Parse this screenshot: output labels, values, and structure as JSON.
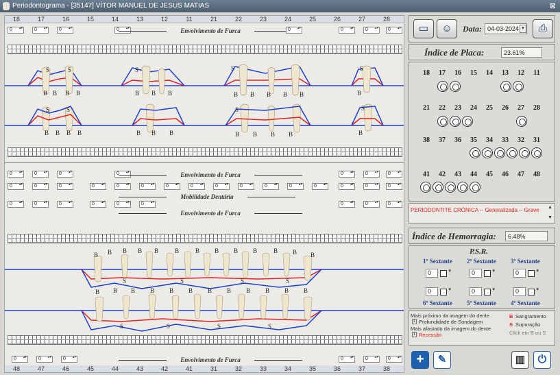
{
  "window": {
    "title": "Periodontograma - [35147] VÍTOR MANUEL DE JESUS MATIAS",
    "close": "⊠"
  },
  "chart": {
    "upper_teeth": [
      "18",
      "17",
      "16",
      "15",
      "14",
      "13",
      "12",
      "11",
      "21",
      "22",
      "23",
      "24",
      "25",
      "26",
      "27",
      "28"
    ],
    "lower_teeth": [
      "48",
      "47",
      "46",
      "45",
      "44",
      "43",
      "42",
      "41",
      "31",
      "32",
      "33",
      "34",
      "35",
      "36",
      "37",
      "38"
    ],
    "spinner_value": "0",
    "furca_label": "Envolvimento de Furca",
    "mobilidade_label": "Mobilidade Dentária",
    "bleed_marker": "B",
    "supp_marker": "S"
  },
  "toolbar": {
    "date_label": "Data:",
    "date_value": "04-03-2024"
  },
  "placa": {
    "label": "Índice de Placa:",
    "value": "23.61%"
  },
  "diagram": {
    "row1": [
      "18",
      "17",
      "16",
      "15",
      "14",
      "13",
      "12",
      "11"
    ],
    "row2": [
      "21",
      "22",
      "23",
      "24",
      "25",
      "26",
      "27",
      "28"
    ],
    "row3": [
      "38",
      "37",
      "36",
      "35",
      "34",
      "33",
      "32",
      "31"
    ],
    "row4": [
      "41",
      "42",
      "43",
      "44",
      "45",
      "46",
      "47",
      "48"
    ]
  },
  "diagnosis": "PERIODONTITE CRÓNICA -- Generalizada -- Grave",
  "hemorragia": {
    "label": "Índice de Hemorragia:",
    "value": "6.48%"
  },
  "psr": {
    "title": "P.S.R.",
    "sextants": [
      "1º Sextante",
      "2º Sextante",
      "3º Sextante",
      "6º Sextante",
      "5º Sextante",
      "4º Sextante"
    ],
    "value": "0",
    "star": "*"
  },
  "legend": {
    "near": "Mais próximo da imagem do dente",
    "probing": "Profundidade de Sondagem",
    "far": "Mais afastado da imagem do dente",
    "recession": "Recessão",
    "bleeding": "Sangramento",
    "suppuration": "Supuração",
    "hint": "Click em B ou S",
    "b_letter": "B",
    "s_letter": "S",
    "i_letter": "1"
  },
  "colors": {
    "red": "#e02020",
    "blue": "#1f3fd0",
    "accent": "#1e5fae"
  }
}
